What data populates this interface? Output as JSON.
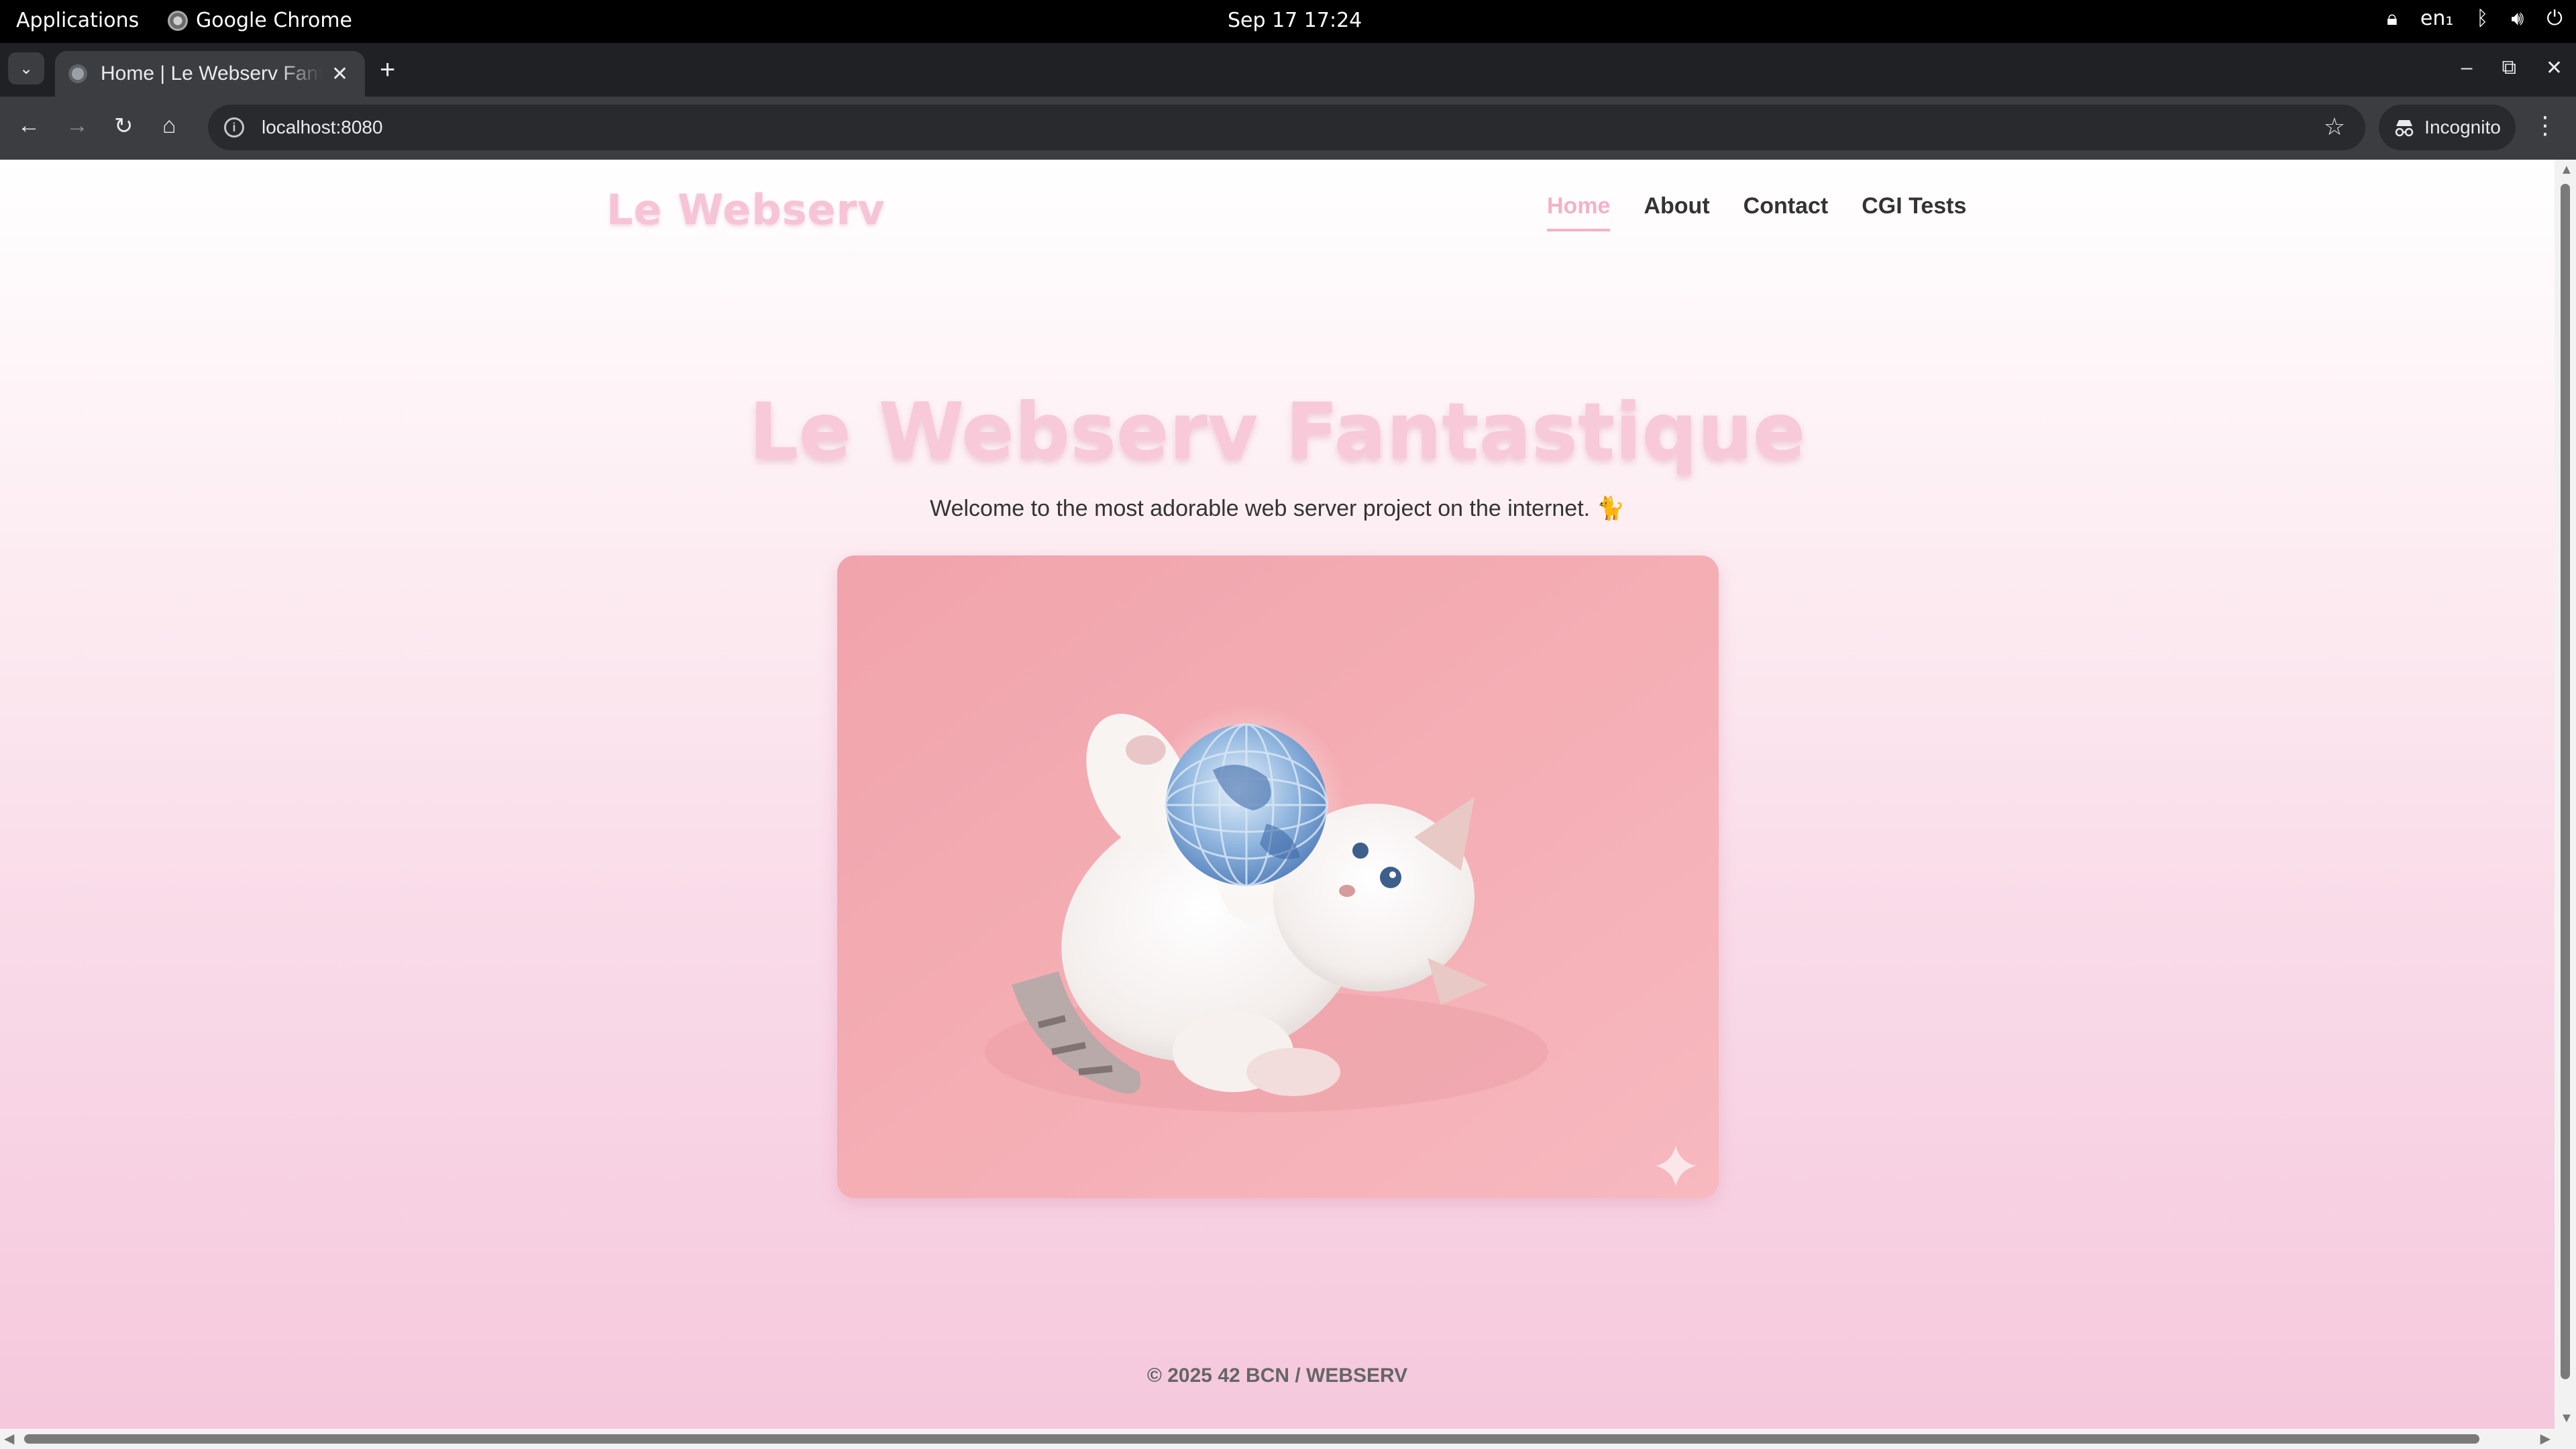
{
  "system_bar": {
    "applications_label": "Applications",
    "app_name": "Google Chrome",
    "clock": "Sep 17  17:24",
    "keyboard_layout": "en₁"
  },
  "browser": {
    "tab_title": "Home | Le Webserv Fantastique",
    "url": "localhost:8080",
    "incognito_label": "Incognito"
  },
  "page": {
    "logo": "Le Webserv",
    "nav": [
      "Home",
      "About",
      "Contact",
      "CGI Tests"
    ],
    "active_nav": "Home",
    "hero_title": "Le Webserv Fantastique",
    "hero_subtitle": "Welcome to the most adorable web server project on the internet. 🐈",
    "footer": "© 2025 42 BCN / WEBSERV",
    "colors": {
      "accent_pink": "#f4b1c8",
      "title_pink": "#f7c9d9",
      "text_dark": "#333333"
    }
  }
}
